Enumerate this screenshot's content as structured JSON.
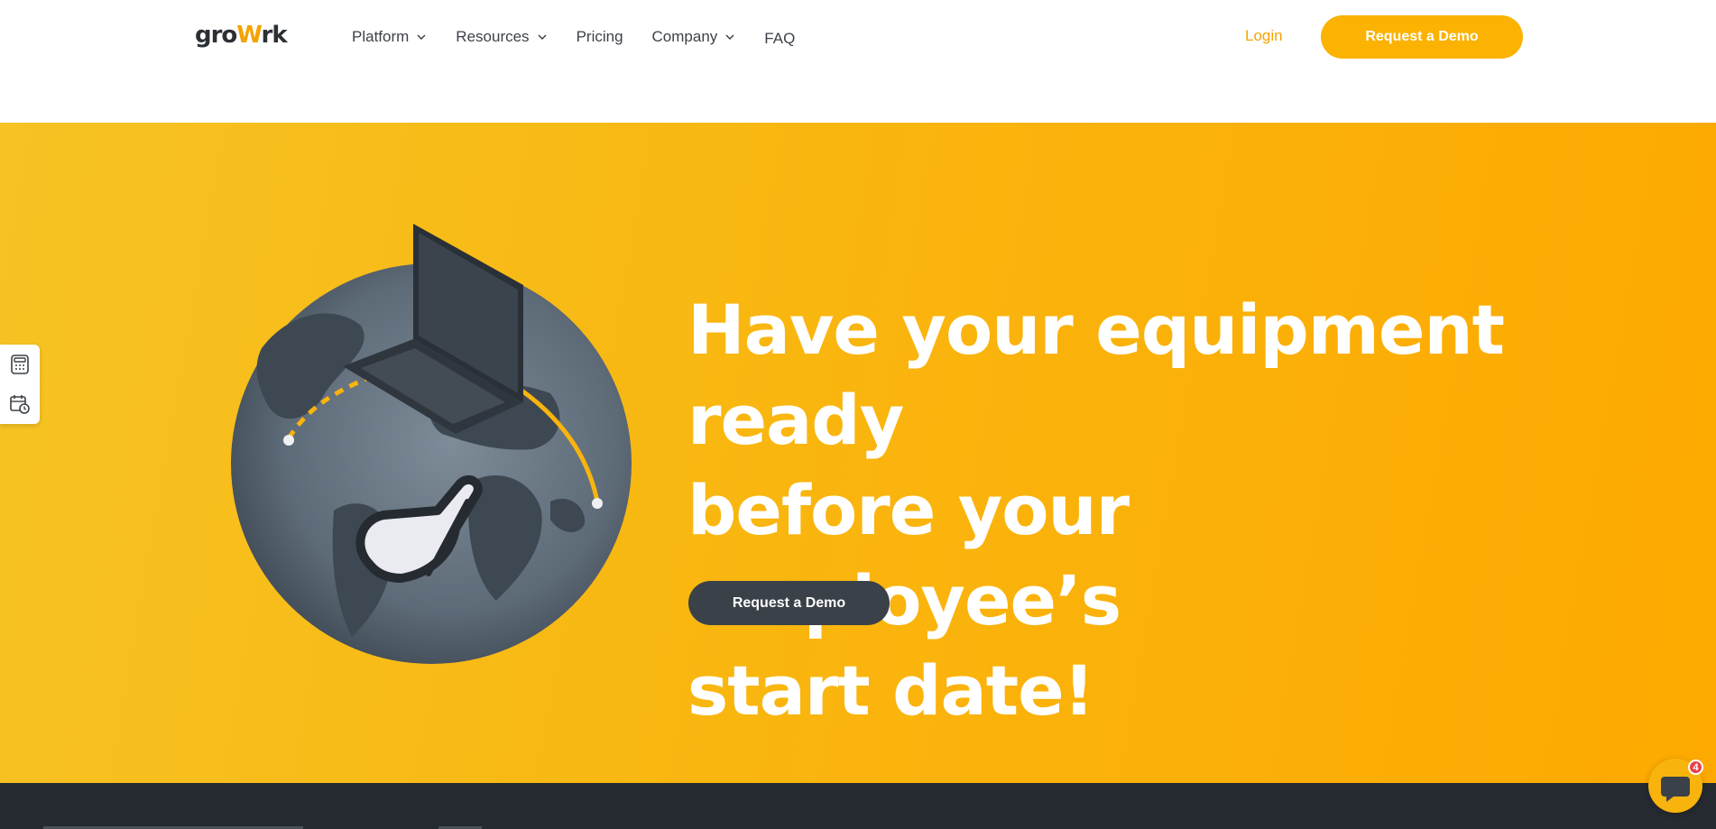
{
  "header": {
    "logo": {
      "part1": "gro",
      "part2": "W",
      "part3": "rk"
    },
    "nav": [
      {
        "label": "Platform",
        "has_dropdown": true
      },
      {
        "label": "Resources",
        "has_dropdown": true
      },
      {
        "label": "Pricing",
        "has_dropdown": false
      },
      {
        "label": "Company",
        "has_dropdown": true
      },
      {
        "label": "FAQ",
        "has_dropdown": false
      }
    ],
    "login_label": "Login",
    "cta_label": "Request a Demo"
  },
  "hero": {
    "title_lines": [
      "Have your equipment ready",
      "before your employee’s",
      "start date!"
    ],
    "cta_label": "Request a Demo"
  },
  "side_widget": {
    "icons": [
      "calculator-icon",
      "calendar-clock-icon"
    ]
  },
  "chat": {
    "badge_count": "4",
    "icon": "chat-bubble-icon"
  },
  "colors": {
    "brand_yellow": "#fbb200",
    "hero_gradient_start": "#f6c324",
    "hero_gradient_end": "#fda900",
    "dark": "#3b4148",
    "band": "#262b31"
  }
}
